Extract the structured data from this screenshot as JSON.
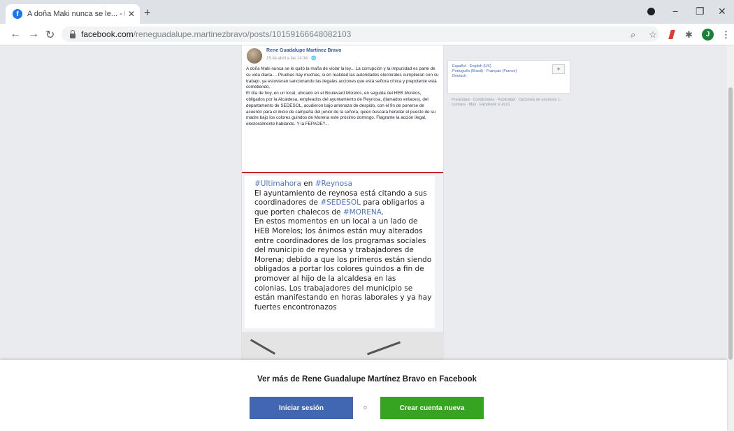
{
  "browser": {
    "tab_title": "A doña Maki nunca se le... - Rene",
    "tab_close": "✕",
    "new_tab": "+",
    "window_minimize": "−",
    "window_restore": "❐",
    "window_close": "✕",
    "url_domain": "facebook.com",
    "url_path": "/reneguadalupe.martinezbravo/posts/10159166648082103",
    "profile_initial": "J",
    "icons": [
      "back-icon",
      "forward-icon",
      "reload-icon",
      "lock-icon",
      "zoom-icon",
      "star-icon",
      "extension-icon",
      "puzzle-icon",
      "menu-icon"
    ]
  },
  "post": {
    "author": "Rene Guadalupe Martínez Bravo",
    "date": "15 de abril a las 14:34 · 🌐",
    "text_p1": "A doña Maki nunca se le quitó la maña de violar la ley... La corrupción y la impunidad es parte de su vida diaria.... Pruebas hay muchas, si en realidad las autoridades electorales cumplieran con su trabajo, ya estuvieran sancionando las ilegales acciones que está señora cínica y prepotente está cometiendo.",
    "text_p2": "El día de hoy, en un local, ubicado en el Boulevard Morelos, en seguida del HEB Morelos, obligados por la Alcaldesa, empleados del ayuntamiento de Reynosa, (llamados enlaces), del departamento de SEDESOL, acudieron bajo amenaza de despido, con el fin de ponerse de acuerdo para el inicio de campaña del junior de la señora, quien buscará heredar el puesto de su madre bajo los colores guindos de Morena este próximo domingo. Flagrante la acción ilegal, electoralmente hablando. Y la FEPADE?...",
    "shared": {
      "hashtag1": "#Ultimahora",
      "en": "en",
      "hashtag2": "#Reynosa",
      "line1": "El ayuntamiento de reynosa está citando a sus coordinadores de",
      "hashtag3": "#SEDESOL",
      "line2": "para obligarlos a que porten chalecos de",
      "hashtag4": "#MORENA",
      "dot": ".",
      "line3": "En estos momentos en un local a un lado de HEB Morelos; los ánimos están muy alterados entre coordinadores de los programas sociales del municipio de reynosa y trabajadores de Morena; debido a que los primeros están siendo obligados a portar los colores guindos a fin de promover al hijo de la alcaldesa en las",
      "line4": "colonias. Los trabajadores del municipio se están manifestando en horas laborales y ya hay fuertes encontronazos"
    }
  },
  "sidebar": {
    "lang1": "Español",
    "lang2": "English (US)",
    "lang3": "Português (Brasil)",
    "lang4": "Français (France)",
    "lang5": "Deutsch",
    "sep": " · ",
    "plus": "+",
    "footer": "Privacidad · Condiciones · Publicidad · Opciones de anuncios ▷ · Cookies · Más · Facebook © 2021"
  },
  "banner": {
    "title": "Ver más de Rene Guadalupe Martínez Bravo en Facebook",
    "login": "Iniciar sesión",
    "or": "o",
    "create": "Crear cuenta nueva"
  }
}
